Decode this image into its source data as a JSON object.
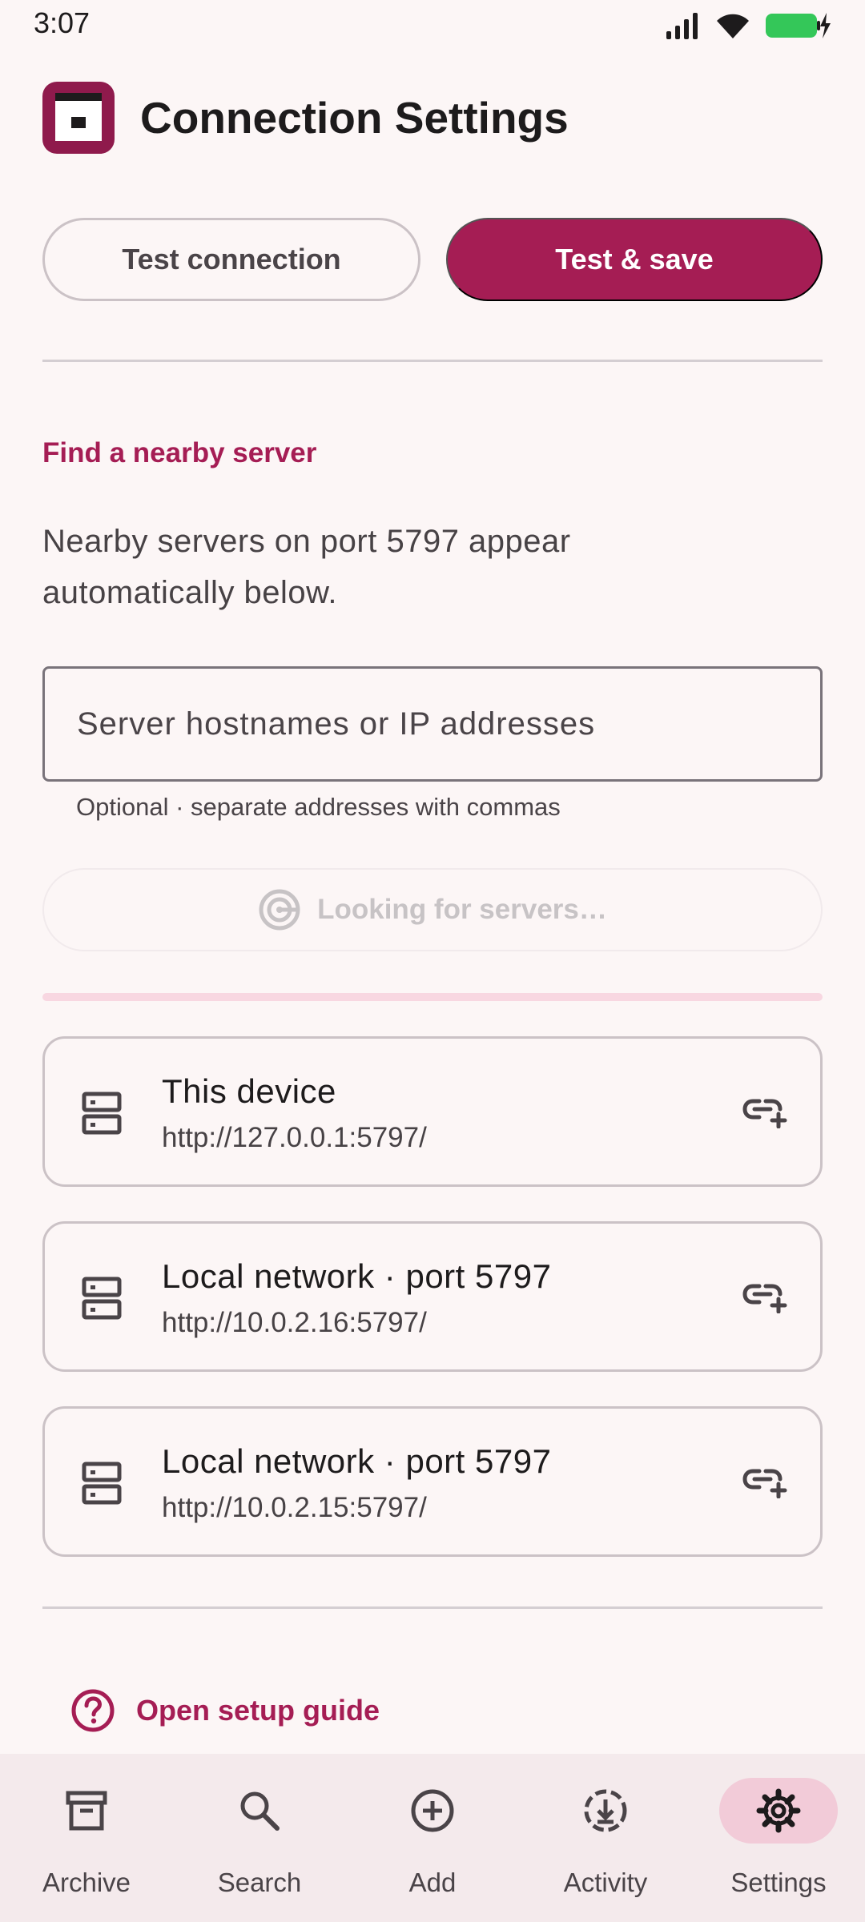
{
  "status_bar": {
    "time": "3:07"
  },
  "header": {
    "title": "Connection Settings"
  },
  "actions": {
    "test_label": "Test connection",
    "save_label": "Test & save"
  },
  "discovery": {
    "section_title": "Find a nearby server",
    "description": "Nearby servers on port 5797 appear automatically below.",
    "input_placeholder": "Server hostnames or IP addresses",
    "input_value": "",
    "helper_text": "Optional · separate addresses with commas",
    "searching_label": "Looking for servers…",
    "progress": 0
  },
  "servers": [
    {
      "name": "This device",
      "url": "http://127.0.0.1:5797/"
    },
    {
      "name": "Local network · port 5797",
      "url": "http://10.0.2.16:5797/"
    },
    {
      "name": "Local network · port 5797",
      "url": "http://10.0.2.15:5797/"
    }
  ],
  "guide": {
    "label": "Open setup guide"
  },
  "nav": {
    "active": "Settings",
    "items": [
      {
        "label": "Archive",
        "icon": "archive-icon"
      },
      {
        "label": "Search",
        "icon": "search-icon"
      },
      {
        "label": "Add",
        "icon": "add-circle-icon"
      },
      {
        "label": "Activity",
        "icon": "download-progress-icon"
      },
      {
        "label": "Settings",
        "icon": "gear-icon"
      }
    ]
  },
  "colors": {
    "accent": "#a51d54",
    "background": "#fcf6f6",
    "nav_background": "#f4eaec",
    "nav_active_pill": "#f2cbd8"
  }
}
